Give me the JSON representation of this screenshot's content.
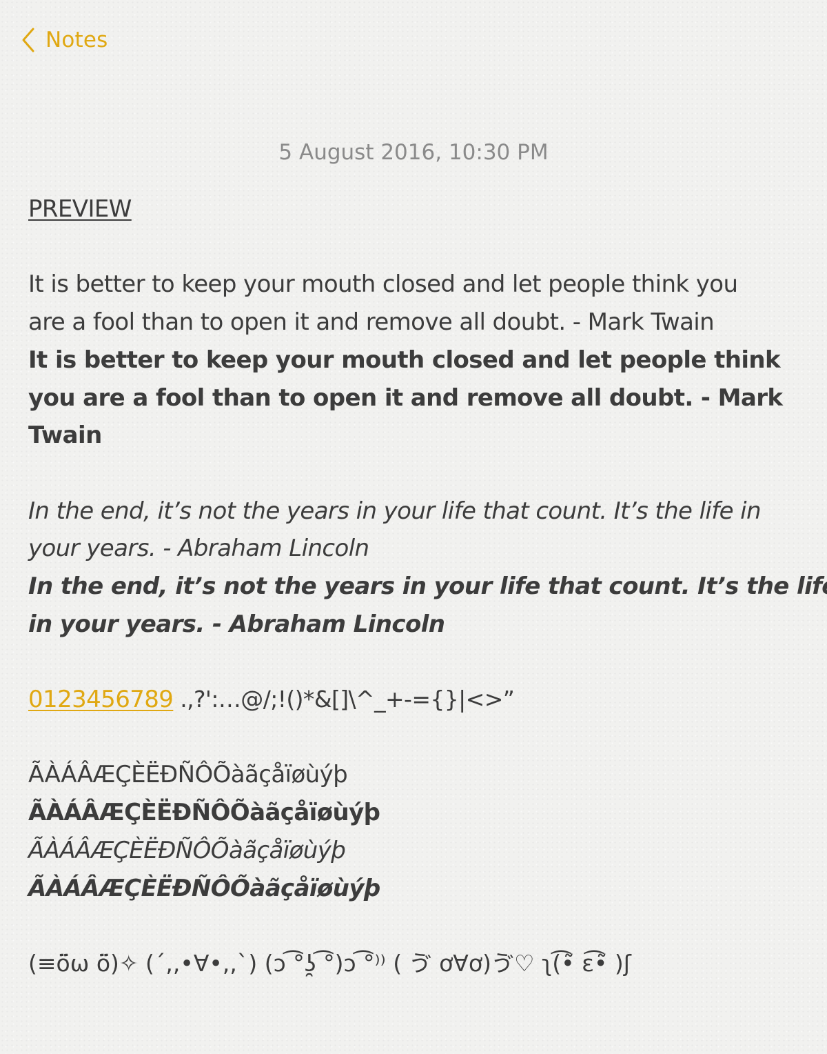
{
  "nav": {
    "back_label": "Notes",
    "accent_color": "#e0a812",
    "back_icon": "chevron-left-icon"
  },
  "note": {
    "date": "5 August 2016, 10:30 PM",
    "heading": "PREVIEW",
    "quote1_regular": [
      "It is better to keep your mouth closed and let people think you",
      "are a fool than to open it and remove all doubt. - Mark Twain"
    ],
    "quote1_bold": [
      "It is better to keep your mouth closed and let people think",
      "you are a fool than to open it and remove all doubt. - Mark",
      "Twain"
    ],
    "quote2_italic": [
      "In the end, it’s not the years in your life that count. It’s the life in",
      "your years. - Abraham Lincoln"
    ],
    "quote2_bold_italic": [
      "In the end, it’s not the years in your life that count. It’s the life",
      "in your years. - Abraham Lincoln"
    ],
    "numbers_link": "0123456789",
    "symbols": " .,?':…@/;!()*&[]\\^_+-={}|<>”",
    "accents_regular": "ÃÀÁÂÆÇÈËÐÑÔÕàãçåïøùýþ",
    "accents_bold": "ÃÀÁÂÆÇÈËÐÑÔÕàãçåïøùýþ",
    "accents_italic": "ÃÀÁÂÆÇÈËÐÑÔÕàãçåïøùýþ",
    "accents_bold_italic": "ÃÀÁÂÆÇÈËÐÑÔÕàãçåïøùýþ",
    "kaomoji": "(≡ö̈ω ö̈)✧  (´,,•∀•,,`)  (ↄ ͡°ʖ̯ ͡°)ↄ ͡°⁾⁾  ( ゔ ơ∀ơ)ゔ♡  ʅ(͡•̃ ε͡•̃ )ʃ"
  }
}
